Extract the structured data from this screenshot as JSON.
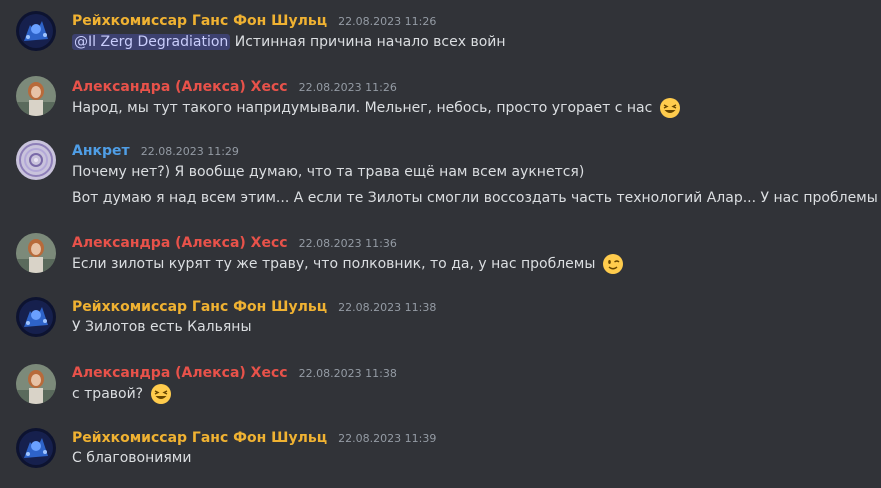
{
  "colors": {
    "author_reich": "#f0b232",
    "author_alexandra": "#e8524a",
    "author_ankret": "#4f9ee6"
  },
  "messages": [
    {
      "author": "Рейхкомиссар Ганс Фон Шульц",
      "timestamp": "22.08.2023 11:26",
      "mention": "@Il Zerg Degradiation",
      "text": "Истинная причина начало всех войн"
    },
    {
      "author": "Александра (Алекса) Хесс",
      "timestamp": "22.08.2023 11:26",
      "text": "Народ, мы тут такого напридумывали. Мельнег, небось, просто угорает с нас",
      "emoji": "laughing-emoji"
    },
    {
      "author": "Анкрет",
      "timestamp": "22.08.2023 11:29",
      "text": "Почему нет?) Я вообще думаю, что та трава ещё нам всем аукнется)",
      "text2": "Вот думаю я над всем этим... А если те Зилоты смогли воссоздать часть технологий Алар... У нас проблемы будут"
    },
    {
      "author": "Александра (Алекса) Хесс",
      "timestamp": "22.08.2023 11:36",
      "text": "Если зилоты курят ту же траву, что полковник, то да, у нас проблемы",
      "emoji": "wink-emoji"
    },
    {
      "author": "Рейхкомиссар Ганс Фон Шульц",
      "timestamp": "22.08.2023 11:38",
      "text": "У Зилотов есть Кальяны"
    },
    {
      "author": "Александра (Алекса) Хесс",
      "timestamp": "22.08.2023 11:38",
      "text": "с травой?",
      "emoji": "laughing-emoji"
    },
    {
      "author": "Рейхкомиссар Ганс Фон Шульц",
      "timestamp": "22.08.2023 11:39",
      "text": "С благовониями"
    }
  ]
}
